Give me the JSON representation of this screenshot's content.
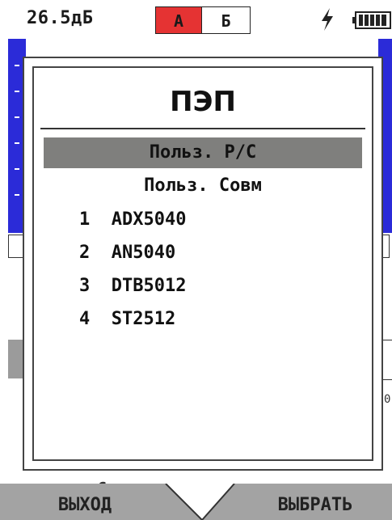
{
  "status_bar": {
    "gain": "26.5дБ",
    "tab_a": "А",
    "tab_b": "Б",
    "charging_icon": "lightning-bolt",
    "battery_icon": "battery-full",
    "accent_color": "#e53333"
  },
  "dialog": {
    "title": "ПЭП",
    "options": [
      "Польз. Р/С",
      "Польз. Совм"
    ],
    "selected_index": 0,
    "probes": [
      {
        "num": "1",
        "name": "ADX5040"
      },
      {
        "num": "2",
        "name": "AN5040"
      },
      {
        "num": "3",
        "name": "DTB5012"
      },
      {
        "num": "4",
        "name": "ST2512"
      }
    ]
  },
  "background": {
    "partial_label": "Стрела",
    "partial_value": "0",
    "scan_color": "#2b2bd8"
  },
  "softkeys": {
    "exit_label": "ВЫХОД",
    "select_label": "ВЫБРАТЬ"
  }
}
